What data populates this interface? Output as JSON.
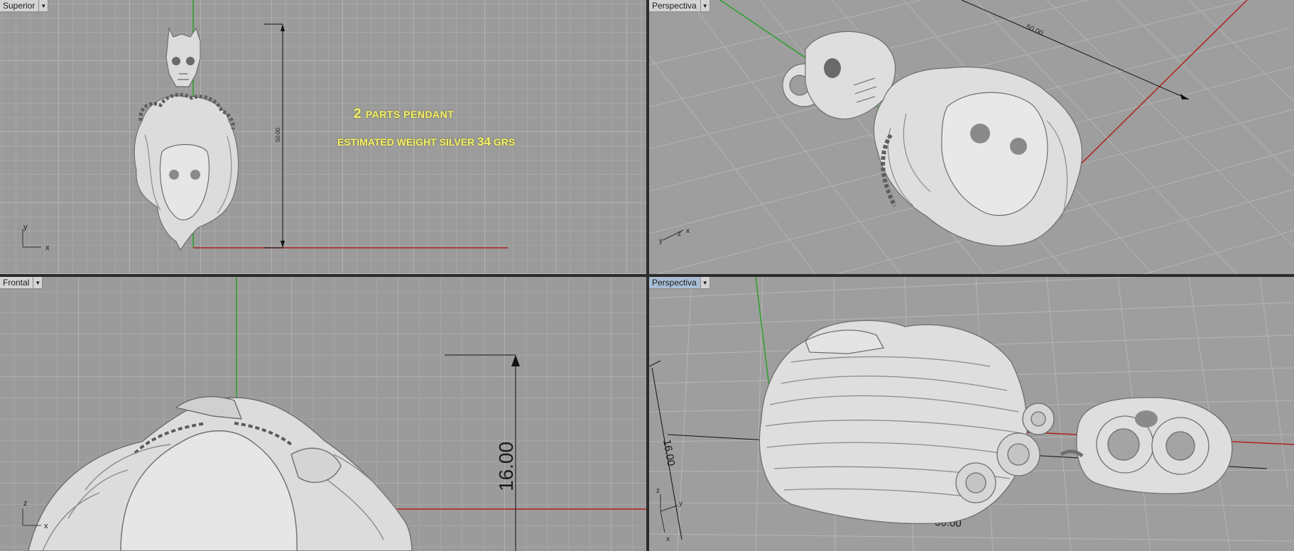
{
  "viewports": {
    "top": {
      "label": "Superior",
      "dim_text": "50.00",
      "axis_x": "x",
      "axis_y": "y"
    },
    "persp1": {
      "label": "Perspectiva",
      "dim_text": "50.00",
      "axis_x": "x",
      "axis_y": "y",
      "axis_z": "z"
    },
    "front": {
      "label": "Frontal",
      "dim_text": "16.00",
      "axis_x": "x",
      "axis_z": "z"
    },
    "persp2": {
      "label": "Perspectiva",
      "dim_text_h": "16.00",
      "dim_text_w": "50.00",
      "axis_x": "x",
      "axis_y": "y",
      "axis_z": "z"
    }
  },
  "annotations": {
    "line1_num": "2",
    "line1_text": "PARTS PENDANT",
    "line2_text": "ESTIMATED WEIGHT SILVER",
    "line2_num": "34",
    "line2_unit": "GRS"
  },
  "colors": {
    "x_axis": "#b02020",
    "y_axis": "#2aa02a",
    "viewport_bg": "#9e9e9e",
    "active_tab": "#a9bdd6",
    "annotation": "#f4f06a"
  }
}
